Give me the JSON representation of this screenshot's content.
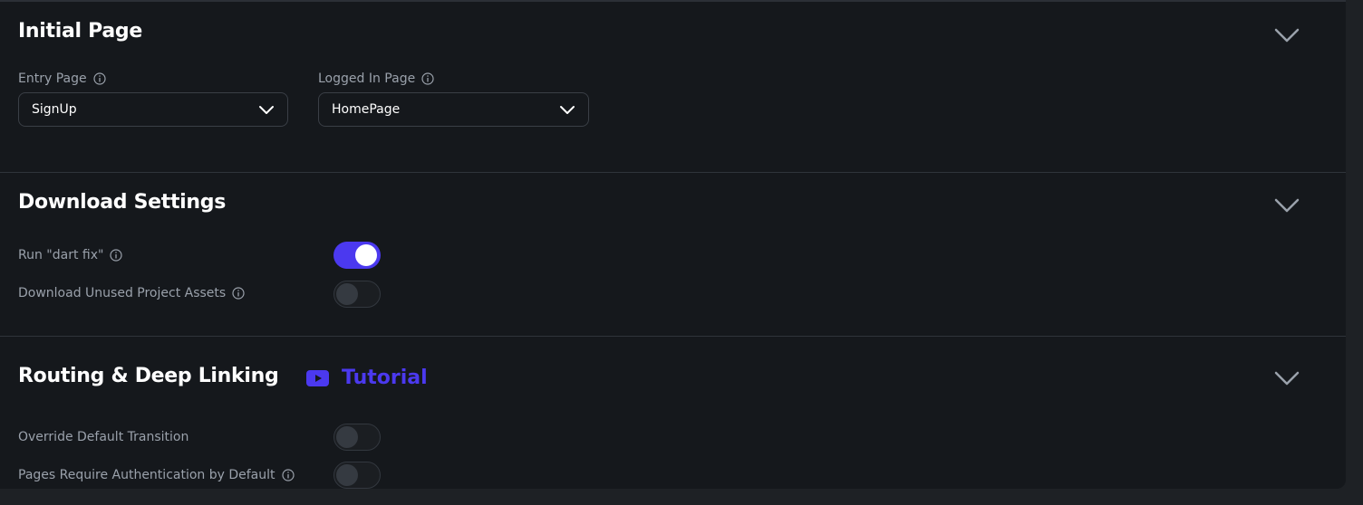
{
  "sections": {
    "initial_page": {
      "title": "Initial Page",
      "entry_page": {
        "label": "Entry Page",
        "value": "SignUp"
      },
      "logged_in_page": {
        "label": "Logged In Page",
        "value": "HomePage"
      }
    },
    "download_settings": {
      "title": "Download Settings",
      "dart_fix": {
        "label": "Run \"dart fix\"",
        "enabled": true
      },
      "unused_assets": {
        "label": "Download Unused Project Assets",
        "enabled": false
      }
    },
    "routing": {
      "title": "Routing & Deep Linking",
      "tutorial_label": "Tutorial",
      "override_transition": {
        "label": "Override Default Transition",
        "enabled": false
      },
      "require_auth": {
        "label": "Pages Require Authentication by Default",
        "enabled": false
      }
    }
  },
  "colors": {
    "accent": "#4b39ef",
    "background": "#15181c",
    "muted_text": "#9aa1ab"
  },
  "icons": {
    "info": "info-icon",
    "chevron": "chevron-down-icon",
    "video": "youtube-icon"
  }
}
